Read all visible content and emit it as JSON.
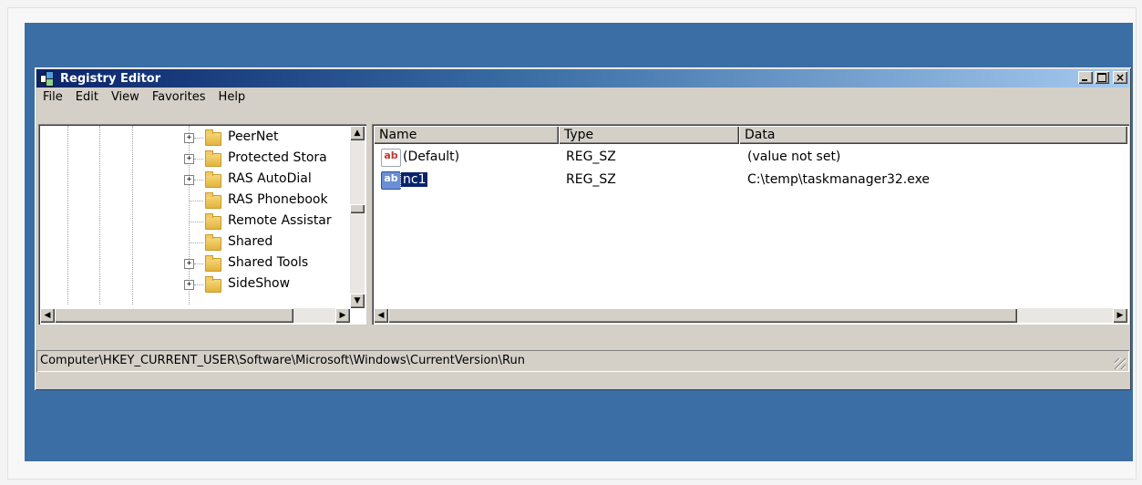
{
  "window": {
    "title": "Registry Editor",
    "title_buttons": {
      "close": "×"
    }
  },
  "menu": [
    "File",
    "Edit",
    "View",
    "Favorites",
    "Help"
  ],
  "tree": {
    "items": [
      {
        "label": "PeerNet",
        "expander": "+"
      },
      {
        "label": "Protected Stora",
        "expander": "+"
      },
      {
        "label": "RAS AutoDial",
        "expander": "+"
      },
      {
        "label": "RAS Phonebook",
        "expander": ""
      },
      {
        "label": "Remote Assistar",
        "expander": ""
      },
      {
        "label": "Shared",
        "expander": ""
      },
      {
        "label": "Shared Tools",
        "expander": "+"
      },
      {
        "label": "SideShow",
        "expander": "+"
      }
    ]
  },
  "list": {
    "columns": [
      "Name",
      "Type",
      "Data"
    ],
    "rows": [
      {
        "name": "(Default)",
        "type": "REG_SZ",
        "data": "(value not set)",
        "icon": "ab"
      },
      {
        "name": "nc1",
        "type": "REG_SZ",
        "data": "C:\\temp\\taskmanager32.exe",
        "icon": "ab"
      }
    ]
  },
  "statusbar": {
    "path": "Computer\\HKEY_CURRENT_USER\\Software\\Microsoft\\Windows\\CurrentVersion\\Run"
  },
  "scroll_glyphs": {
    "up": "▲",
    "down": "▼",
    "left": "◀",
    "right": "▶"
  }
}
